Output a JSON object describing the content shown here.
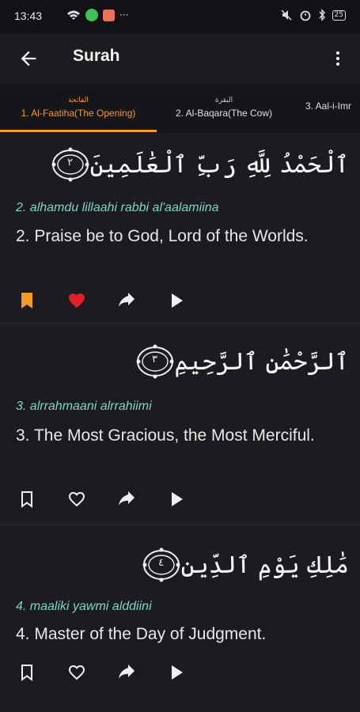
{
  "status": {
    "time": "13:43",
    "battery": "25"
  },
  "appbar": {
    "title": "Surah"
  },
  "tabs": [
    {
      "ar": "الفاتحة",
      "en": "1. Al-Faatiha(The Opening)",
      "active": true
    },
    {
      "ar": "البقرة",
      "en": "2. Al-Baqara(The Cow)",
      "active": false
    },
    {
      "ar": "",
      "en": "3. Aal-i-Imr",
      "active": false
    }
  ],
  "ayahs": [
    {
      "arabic": "ٱلْحَمْدُ لِلَّهِ رَبِّ ٱلْعَٰلَمِينَ",
      "number": "٢",
      "transliteration": "2. alhamdu lillaahi rabbi al'aalamiina",
      "translation": "2. Praise be to God, Lord of the Worlds.",
      "bookmarked": true,
      "favorited": true
    },
    {
      "arabic": "ٱلرَّحْمَٰنِ ٱلرَّحِيمِ",
      "number": "٣",
      "transliteration": "3. alrrahmaani alrrahiimi",
      "translation": "3. The Most Gracious, the Most Merciful.",
      "bookmarked": false,
      "favorited": false
    },
    {
      "arabic": "مَٰلِكِ يَوْمِ ٱلدِّينِ",
      "number": "٤",
      "transliteration": "4. maaliki yawmi alddiini",
      "translation": "4. Master of the Day of Judgment.",
      "bookmarked": false,
      "favorited": false
    }
  ],
  "colors": {
    "accent": "#f29b27",
    "favorite": "#e0202b",
    "transliteration": "#7fd4c8",
    "background": "#1c1b20"
  }
}
